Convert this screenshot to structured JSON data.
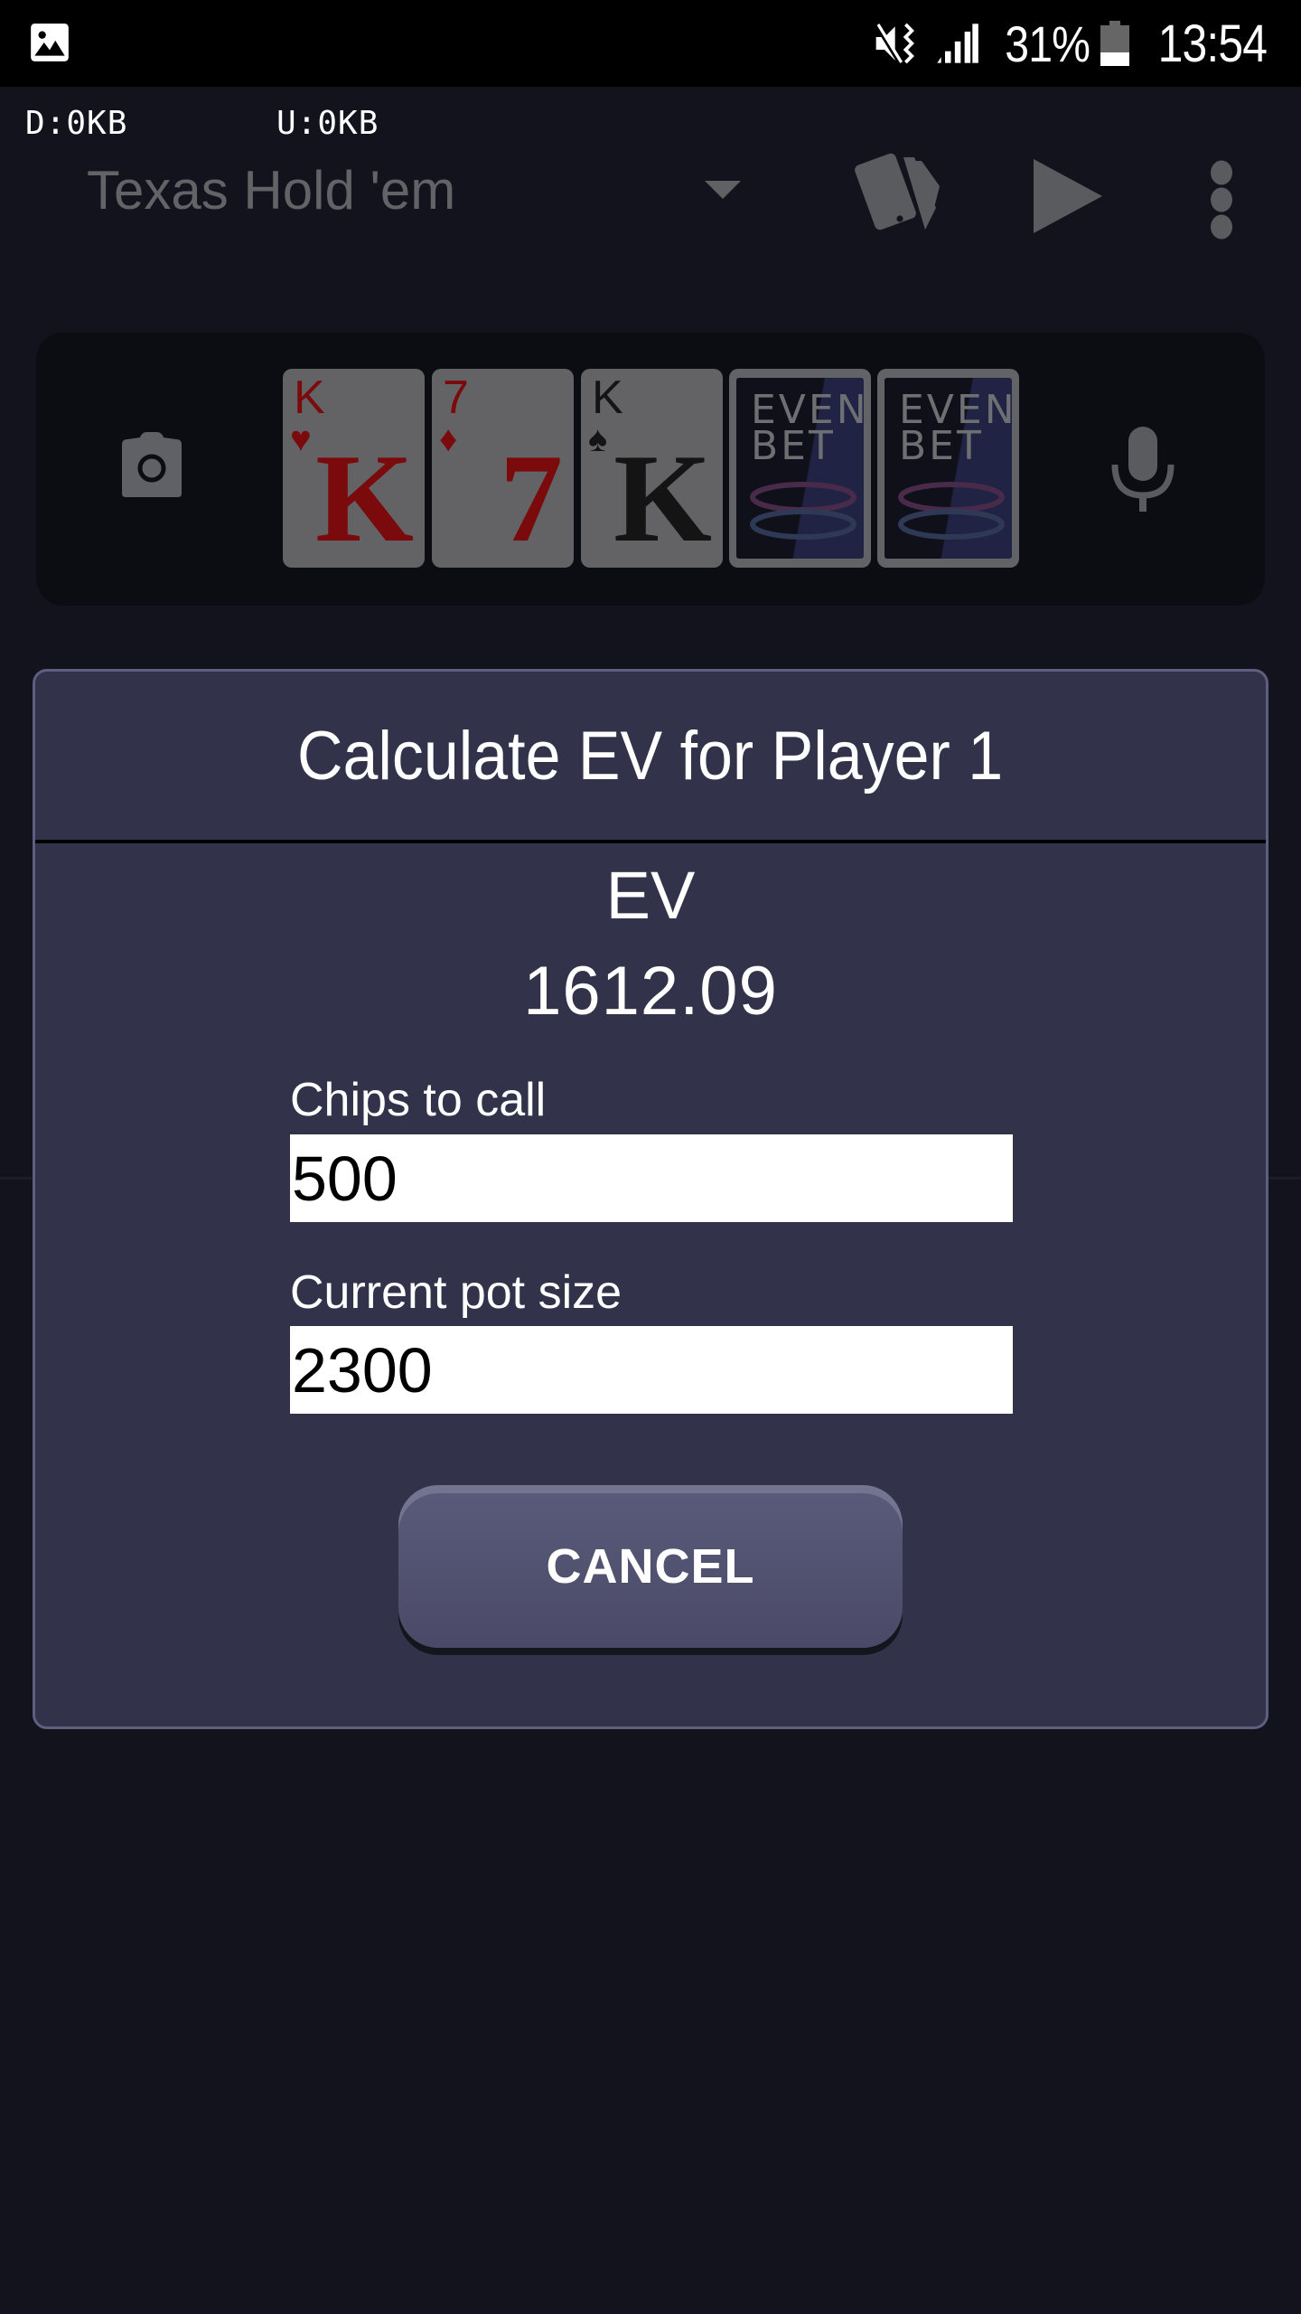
{
  "status_bar": {
    "notification_icon": "gallery-icon",
    "icons": [
      "mute-vibrate-icon",
      "signal-icon",
      "battery-icon"
    ],
    "battery_percent": "31%",
    "clock": "13:54"
  },
  "app_bar": {
    "traffic_download": "D:0KB",
    "traffic_upload": "U:0KB",
    "game_selector_value": "Texas Hold 'em",
    "actions": [
      "cards-icon",
      "play-icon",
      "more-options-icon"
    ]
  },
  "card_panel": {
    "left_action": "camera-icon",
    "right_action": "microphone-icon",
    "cards": [
      {
        "rank": "K",
        "suit": "♥",
        "color": "red",
        "face_up": true
      },
      {
        "rank": "7",
        "suit": "♦",
        "color": "red",
        "face_up": true
      },
      {
        "rank": "K",
        "suit": "♠",
        "color": "black",
        "face_up": true
      },
      {
        "face_up": false,
        "back_brand_line1": "EVEN",
        "back_brand_line2": "BET"
      },
      {
        "face_up": false,
        "back_brand_line1": "EVEN",
        "back_brand_line2": "BET"
      }
    ]
  },
  "dialog": {
    "title": "Calculate EV for Player 1",
    "ev_label": "EV",
    "ev_value": "1612.09",
    "chips_to_call_label": "Chips to call",
    "chips_to_call_value": "500",
    "pot_size_label": "Current pot size",
    "pot_size_value": "2300",
    "cancel_label": "CANCEL"
  },
  "colors": {
    "dialog_bg": "#32334a",
    "dialog_border": "#5d5e80",
    "button_bg": "#50506e",
    "app_bg": "#12131d",
    "red_suit": "#7a0a0c"
  }
}
